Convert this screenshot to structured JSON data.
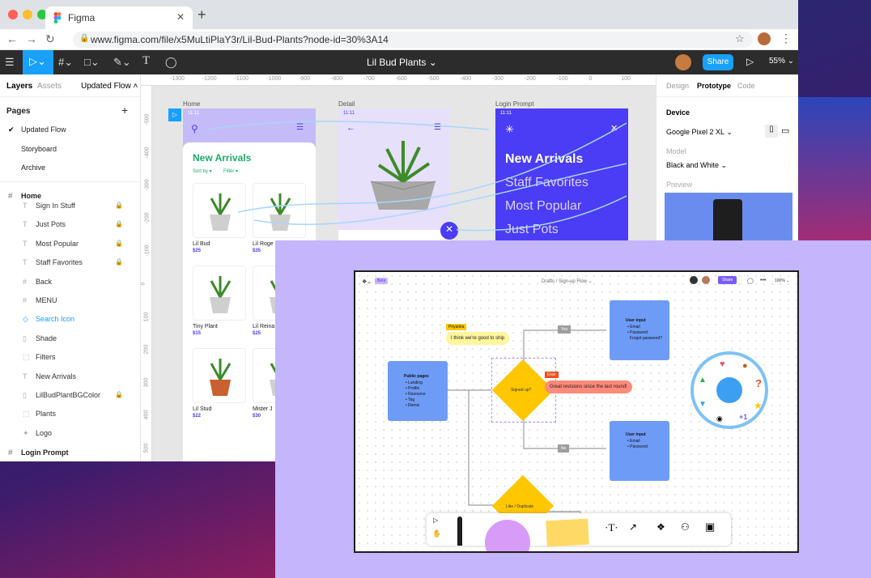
{
  "browser": {
    "tab_title": "Figma",
    "url": "www.figma.com/file/x5MuLtiPlaY3r/Lil-Bud-Plants?node-id=30%3A14"
  },
  "figma": {
    "file_title": "Lil Bud Plants ⌄",
    "share_label": "Share",
    "zoom": "55% ⌄",
    "left_tabs": {
      "layers": "Layers",
      "assets": "Assets",
      "page_sel": "Updated Flow ˄"
    },
    "pages_heading": "Pages",
    "add_page": "+",
    "pages": [
      "Updated Flow",
      "Storyboard",
      "Archive"
    ],
    "frame_home": "Home",
    "layers": [
      {
        "icon": "T",
        "label": "Sign In Stuff",
        "lock": true
      },
      {
        "icon": "T",
        "label": "Just Pots",
        "lock": true
      },
      {
        "icon": "T",
        "label": "Most Popular",
        "lock": true
      },
      {
        "icon": "T",
        "label": "Staff Favorites",
        "lock": true
      },
      {
        "icon": "#",
        "label": "Back",
        "lock": false
      },
      {
        "icon": "#",
        "label": "MENU",
        "lock": false
      },
      {
        "icon": "◇",
        "label": "Search Icon",
        "lock": false
      },
      {
        "icon": "▯",
        "label": "Shade",
        "lock": false
      },
      {
        "icon": "⬚",
        "label": "Filters",
        "lock": false
      },
      {
        "icon": "T",
        "label": "New Arrivals",
        "lock": false
      },
      {
        "icon": "▯",
        "label": "LilBudPlantBGColor",
        "lock": true
      },
      {
        "icon": "⬚",
        "label": "Plants",
        "lock": false
      },
      {
        "icon": "✦",
        "label": "Logo",
        "lock": false
      }
    ],
    "frame_login": "Login Prompt",
    "ruler_h": [
      "-1300",
      "-1200",
      "-1100",
      "-1000",
      "-900",
      "-800",
      "-700",
      "-600",
      "-500",
      "-400",
      "-300",
      "-200",
      "-100",
      "0",
      "100"
    ],
    "ruler_v": [
      "-500",
      "-400",
      "-300",
      "-200",
      "-100",
      "0",
      "100",
      "200",
      "300",
      "400",
      "500"
    ],
    "frames": {
      "home": "Home",
      "detail": "Detail",
      "login": "Login Prompt"
    },
    "time": "11:11",
    "home_screen": {
      "title": "New Arrivals",
      "sort": "Sort by ▾",
      "filter": "Filter ▾",
      "products": [
        {
          "name": "Lil Bud",
          "price": "$25"
        },
        {
          "name": "Lil Roge",
          "price": "$35"
        },
        {
          "name": "Tiny Plant",
          "price": "$15"
        },
        {
          "name": "Lil Reina",
          "price": "$25"
        },
        {
          "name": "Lil Stud",
          "price": "$22"
        },
        {
          "name": "Mister J",
          "price": "$30"
        }
      ]
    },
    "login_screen": {
      "items": [
        "New Arrivals",
        "Staff Favorites",
        "Most Popular",
        "Just Pots"
      ]
    },
    "right_tabs": {
      "design": "Design",
      "prototype": "Prototype",
      "code": "Code"
    },
    "device_heading": "Device",
    "device": "Google Pixel 2 XL ⌄",
    "model_label": "Model",
    "model": "Black and White ⌄",
    "preview_label": "Preview"
  },
  "figjam": {
    "beta": "Beta",
    "breadcrumb": "Drafts / Sign-up Flow ⌄",
    "share": "Share",
    "zoom": "100% ⌄",
    "public_title": "Public pages",
    "public_items": [
      "• Landing",
      "• Profile",
      "• Resource",
      "• Tag",
      "• Remix"
    ],
    "input1_title": "User input",
    "input1_items": [
      "• Email",
      "• Password",
      "Forgot password?"
    ],
    "input2_title": "User input",
    "input2_items": [
      "• Email",
      "• Password"
    ],
    "decision": "Signed up?",
    "decision2": "Like / Duplicate",
    "yes": "Yes",
    "no": "No",
    "priyanka": "Priyanka",
    "priyanka_msg": "I think we're good to ship",
    "eran": "Eran",
    "eran_msg": "Great revisions since the last round!",
    "reaction_plus": "+1"
  },
  "colors": {
    "figma_blue": "#18a0fb",
    "login_purple": "#4b3cf5",
    "green_title": "#1bab6a",
    "lavender": "#c4b5fd",
    "sticky_yellow": "#ffc700"
  }
}
